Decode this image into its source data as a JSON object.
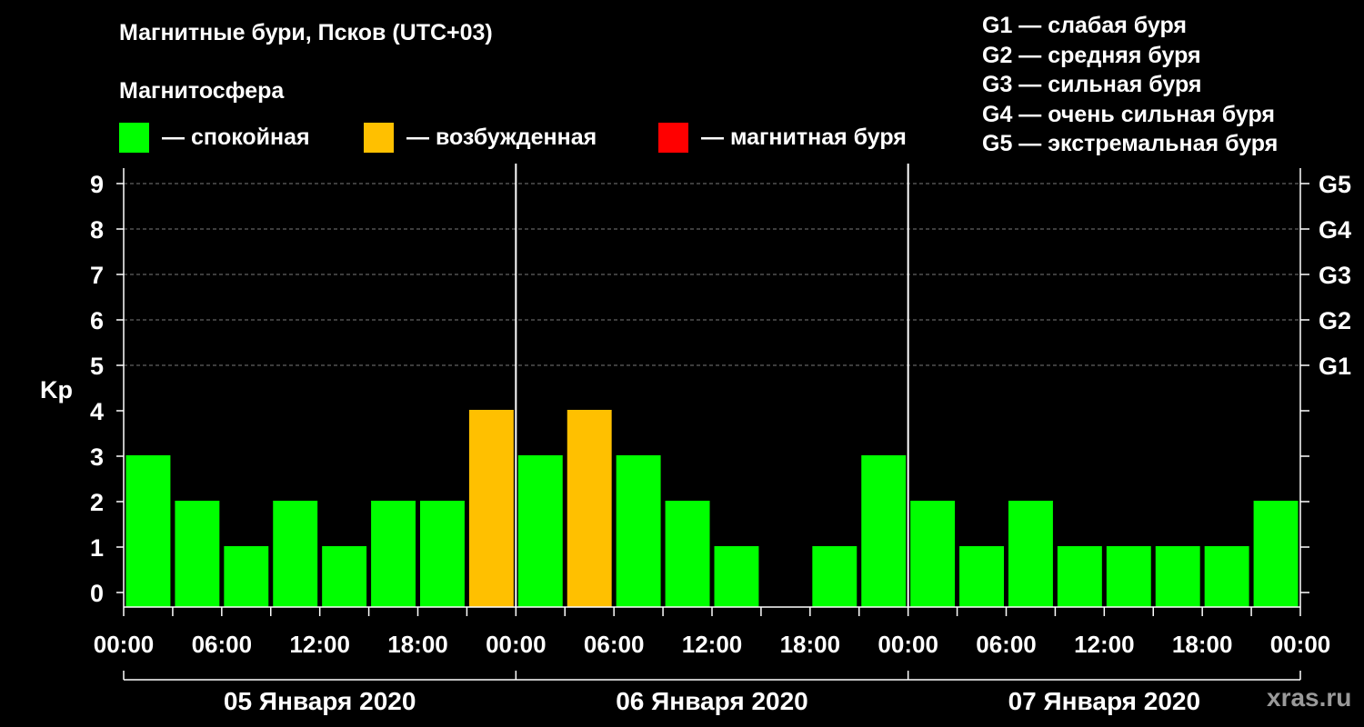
{
  "header": {
    "title": "Магнитные бури, Псков (UTC+03)",
    "subtitle": "Магнитосфера"
  },
  "legend": [
    {
      "label": "— спокойная",
      "color": "#00ff00"
    },
    {
      "label": "— возбужденная",
      "color": "#ffc000"
    },
    {
      "label": "— магнитная буря",
      "color": "#ff0000"
    }
  ],
  "g_legend": [
    "G1 — слабая буря",
    "G2 — средняя буря",
    "G3 — сильная буря",
    "G4 — очень сильная буря",
    "G5 — экстремальная буря"
  ],
  "watermark": "xras.ru",
  "chart_data": {
    "type": "bar",
    "ylabel": "Kp",
    "ylim": [
      0,
      9
    ],
    "yticks": [
      "0",
      "1",
      "2",
      "3",
      "4",
      "5",
      "6",
      "7",
      "8",
      "9"
    ],
    "right_ticks": [
      {
        "value": 5,
        "label": "G1"
      },
      {
        "value": 6,
        "label": "G2"
      },
      {
        "value": 7,
        "label": "G3"
      },
      {
        "value": 8,
        "label": "G4"
      },
      {
        "value": 9,
        "label": "G5"
      }
    ],
    "grid": "horizontal dashed at Kp 5–9",
    "xtick_labels": [
      "00:00",
      "06:00",
      "12:00",
      "18:00",
      "00:00",
      "06:00",
      "12:00",
      "18:00",
      "00:00",
      "06:00",
      "12:00",
      "18:00",
      "00:00"
    ],
    "days": [
      "05 Января 2020",
      "06 Января 2020",
      "07 Января 2020"
    ],
    "values": [
      3,
      2,
      1,
      2,
      1,
      2,
      2,
      4,
      3,
      4,
      3,
      2,
      1,
      0,
      1,
      3,
      2,
      1,
      2,
      1,
      1,
      1,
      1,
      2
    ],
    "colors": {
      "quiet": "#00ff00",
      "excited": "#ffc000",
      "storm": "#ff0000"
    }
  }
}
